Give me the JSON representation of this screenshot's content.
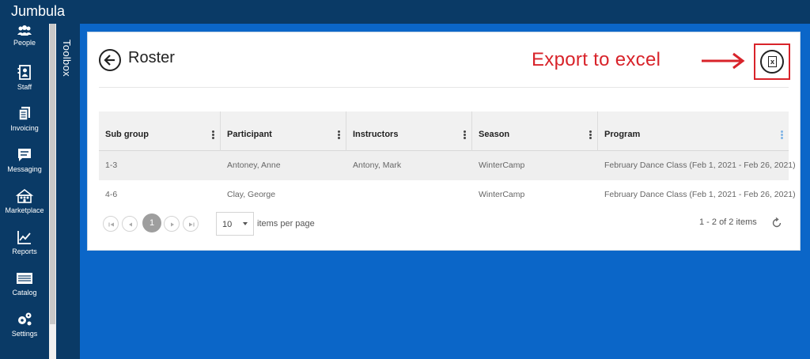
{
  "app": {
    "brand": "Jumbula"
  },
  "nav": {
    "items": [
      {
        "label": "People",
        "icon": "people-icon"
      },
      {
        "label": "Staff",
        "icon": "staff-icon"
      },
      {
        "label": "Invoicing",
        "icon": "invoicing-icon"
      },
      {
        "label": "Messaging",
        "icon": "messaging-icon"
      },
      {
        "label": "Marketplace",
        "icon": "marketplace-icon"
      },
      {
        "label": "Reports",
        "icon": "reports-icon"
      },
      {
        "label": "Catalog",
        "icon": "catalog-icon"
      },
      {
        "label": "Settings",
        "icon": "settings-icon"
      }
    ]
  },
  "toolbox": {
    "label": "Toolbox"
  },
  "page": {
    "title": "Roster"
  },
  "annotation": {
    "text": "Export to excel",
    "color": "#d8232a"
  },
  "grid": {
    "columns": [
      "Sub group",
      "Participant",
      "Instructors",
      "Season",
      "Program"
    ],
    "rows": [
      [
        "1-3",
        "Antoney, Anne",
        "Antony, Mark",
        "WinterCamp",
        "February Dance Class (Feb 1, 2021 - Feb 26, 2021)"
      ],
      [
        "4-6",
        "Clay, George",
        "",
        "WinterCamp",
        "February Dance Class (Feb 1, 2021 - Feb 26, 2021)"
      ]
    ]
  },
  "pager": {
    "current_page": "1",
    "page_size": "10",
    "page_size_label": "items per page",
    "info": "1 - 2 of 2 items"
  },
  "colors": {
    "brand_dark": "#0a3a66",
    "background_blue": "#0b66c8",
    "annotation_red": "#d8232a"
  }
}
